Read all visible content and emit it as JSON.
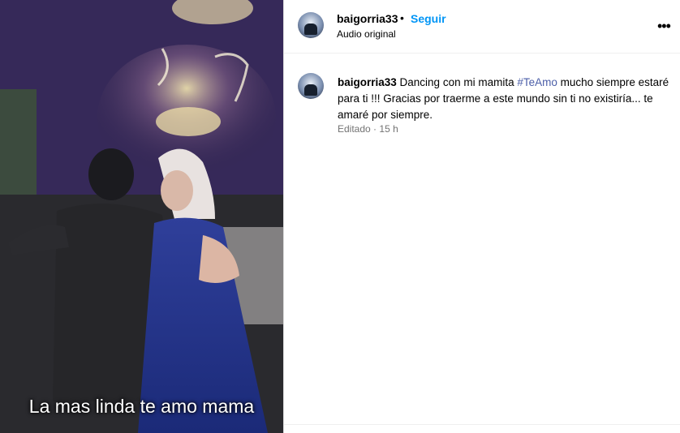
{
  "media": {
    "overlay_text": "La mas linda te amo mama"
  },
  "header": {
    "username": "baigorria33",
    "separator": "•",
    "follow_label": "Seguir",
    "audio_label": "Audio original",
    "more_icon": "more-horizontal-icon"
  },
  "post": {
    "username": "baigorria33",
    "text_before_tag": " Dancing con mi mamita ",
    "hashtag": "#TeAmo",
    "text_after_tag": " mucho siempre estaré para ti !!! Gracias por traerme a este mundo sin ti no existiría... te amaré por siempre.",
    "edited_label": "Editado",
    "meta_separator": "·",
    "time_ago": "15 h"
  }
}
